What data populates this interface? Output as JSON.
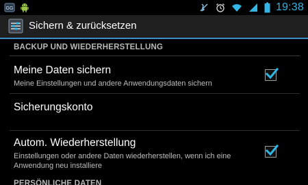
{
  "status_bar": {
    "left_icons": [
      "notification-app-icon",
      "android-icon"
    ],
    "right_icons": [
      "mute-icon",
      "alarm-icon",
      "wifi-icon",
      "signal-icon",
      "battery-icon"
    ],
    "time": "19:38",
    "accent_color": "#33b5e5"
  },
  "action_bar": {
    "icon": "settings-app-icon",
    "title": "Sichern & zurücksetzen"
  },
  "sections": {
    "backup": {
      "header": "BACKUP UND WIEDERHERSTELLUNG",
      "items": [
        {
          "title": "Meine Daten sichern",
          "summary": "Meine Einstellungen und andere Anwendungsdaten sichern",
          "checked": true
        },
        {
          "title": "Sicherungskonto",
          "summary": ""
        },
        {
          "title": "Autom. Wiederherstellung",
          "summary": "Einstellungen oder andere Daten wiederherstellen, wenn ich eine Anwendung neu installiere",
          "checked": true
        }
      ]
    },
    "personal": {
      "header": "PERSÖNLICHE DATEN"
    }
  }
}
